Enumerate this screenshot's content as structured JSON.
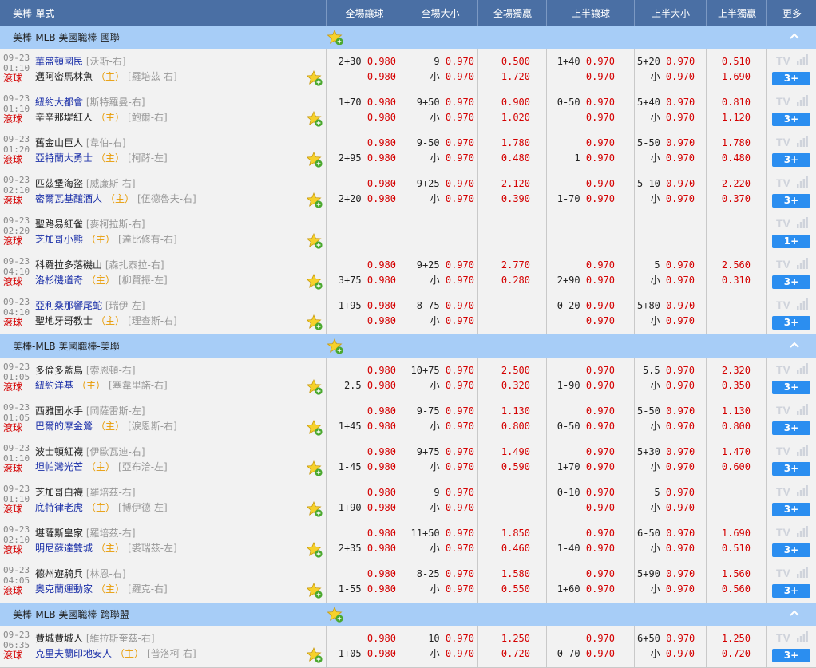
{
  "header": {
    "title": "美棒-單式",
    "cols": [
      "全場讓球",
      "全場大小",
      "全場獨贏",
      "上半讓球",
      "上半大小",
      "上半獨贏",
      "更多"
    ]
  },
  "colors": {
    "header_bg": "#4a6fa4",
    "league_bg": "#a7cdf7",
    "odds_red": "#d40000",
    "more_btn": "#2b8ef0"
  },
  "live_label": "滾球",
  "home_mark": "（主）",
  "tv_label": "TV",
  "leagues": [
    {
      "name": "美棒-MLB 美國職棒-國聯",
      "games": [
        {
          "date": "09-23",
          "time": "01:10",
          "t1": "華盛頓國民",
          "p1": "[沃斯-右]",
          "t2": "邁阿密馬林魚",
          "p2": "[羅培茲-右]",
          "fav": 1,
          "home": 2,
          "hc": [
            "2+30",
            "0.980",
            "",
            "0.980"
          ],
          "ou": [
            "9",
            "0.970",
            "小",
            "0.970"
          ],
          "ml": [
            "0.500",
            "1.720"
          ],
          "hhc": [
            "1+40",
            "0.970",
            "",
            "0.970"
          ],
          "hou": [
            "5+20",
            "0.970",
            "小",
            "0.970"
          ],
          "hml": [
            "0.510",
            "1.690"
          ],
          "more": "3+"
        },
        {
          "date": "09-23",
          "time": "01:10",
          "t1": "紐約大都會",
          "p1": "[斯特羅曼-右]",
          "t2": "辛辛那堤紅人",
          "p2": "[鮑爾-右]",
          "fav": 1,
          "home": 2,
          "hc": [
            "1+70",
            "0.980",
            "",
            "0.980"
          ],
          "ou": [
            "9+50",
            "0.970",
            "小",
            "0.970"
          ],
          "ml": [
            "0.900",
            "1.020"
          ],
          "hhc": [
            "0-50",
            "0.970",
            "",
            "0.970"
          ],
          "hou": [
            "5+40",
            "0.970",
            "小",
            "0.970"
          ],
          "hml": [
            "0.810",
            "1.120"
          ],
          "more": "3+"
        },
        {
          "date": "09-23",
          "time": "01:20",
          "t1": "舊金山巨人",
          "p1": "[韋伯-右]",
          "t2": "亞特蘭大勇士",
          "p2": "[柯酵-左]",
          "fav": 2,
          "home": 2,
          "hc": [
            "",
            "0.980",
            "2+95",
            "0.980"
          ],
          "ou": [
            "9-50",
            "0.970",
            "小",
            "0.970"
          ],
          "ml": [
            "1.780",
            "0.480"
          ],
          "hhc": [
            "",
            "0.970",
            "1",
            "0.970"
          ],
          "hou": [
            "5-50",
            "0.970",
            "小",
            "0.970"
          ],
          "hml": [
            "1.780",
            "0.480"
          ],
          "more": "3+"
        },
        {
          "date": "09-23",
          "time": "02:10",
          "t1": "匹茲堡海盜",
          "p1": "[威廉斯-右]",
          "t2": "密爾瓦基釀酒人",
          "p2": "[伍德魯夫-右]",
          "fav": 2,
          "home": 2,
          "hc": [
            "",
            "0.980",
            "2+20",
            "0.980"
          ],
          "ou": [
            "9+25",
            "0.970",
            "小",
            "0.970"
          ],
          "ml": [
            "2.120",
            "0.390"
          ],
          "hhc": [
            "",
            "0.970",
            "1-70",
            "0.970"
          ],
          "hou": [
            "5-10",
            "0.970",
            "小",
            "0.970"
          ],
          "hml": [
            "2.220",
            "0.370"
          ],
          "more": "3+"
        },
        {
          "date": "09-23",
          "time": "02:20",
          "t1": "聖路易紅雀",
          "p1": "[麥柯拉斯-右]",
          "t2": "芝加哥小熊",
          "p2": "[達比修有-右]",
          "fav": 2,
          "home": 2,
          "hc": [
            "",
            "",
            "",
            ""
          ],
          "ou": [
            "",
            "",
            "",
            ""
          ],
          "ml": [
            "",
            ""
          ],
          "hhc": [
            "",
            "",
            "",
            ""
          ],
          "hou": [
            "",
            "",
            "",
            ""
          ],
          "hml": [
            "",
            ""
          ],
          "more": "1+"
        },
        {
          "date": "09-23",
          "time": "04:10",
          "t1": "科羅拉多落磯山",
          "p1": "[森扎泰拉-右]",
          "t2": "洛杉磯道奇",
          "p2": "[柳賢振-左]",
          "fav": 2,
          "home": 2,
          "hc": [
            "",
            "0.980",
            "3+75",
            "0.980"
          ],
          "ou": [
            "9+25",
            "0.970",
            "小",
            "0.970"
          ],
          "ml": [
            "2.770",
            "0.280"
          ],
          "hhc": [
            "",
            "0.970",
            "2+90",
            "0.970"
          ],
          "hou": [
            "5",
            "0.970",
            "小",
            "0.970"
          ],
          "hml": [
            "2.560",
            "0.310"
          ],
          "more": "3+"
        },
        {
          "date": "09-23",
          "time": "04:10",
          "t1": "亞利桑那響尾蛇",
          "p1": "[瑞伊-左]",
          "t2": "聖地牙哥教士",
          "p2": "[理查斯-右]",
          "fav": 1,
          "home": 2,
          "hc": [
            "1+95",
            "0.980",
            "",
            "0.980"
          ],
          "ou": [
            "8-75",
            "0.970",
            "小",
            "0.970"
          ],
          "ml": [
            "",
            ""
          ],
          "hhc": [
            "0-20",
            "0.970",
            "",
            "0.970"
          ],
          "hou": [
            "5+80",
            "0.970",
            "小",
            "0.970"
          ],
          "hml": [
            "",
            ""
          ],
          "more": "3+"
        }
      ]
    },
    {
      "name": "美棒-MLB 美國職棒-美聯",
      "games": [
        {
          "date": "09-23",
          "time": "01:05",
          "t1": "多倫多藍鳥",
          "p1": "[索恩頓-右]",
          "t2": "紐約洋基",
          "p2": "[塞韋里諾-右]",
          "fav": 2,
          "home": 2,
          "hc": [
            "",
            "0.980",
            "2.5",
            "0.980"
          ],
          "ou": [
            "10+75",
            "0.970",
            "小",
            "0.970"
          ],
          "ml": [
            "2.500",
            "0.320"
          ],
          "hhc": [
            "",
            "0.970",
            "1-90",
            "0.970"
          ],
          "hou": [
            "5.5",
            "0.970",
            "小",
            "0.970"
          ],
          "hml": [
            "2.320",
            "0.350"
          ],
          "more": "3+"
        },
        {
          "date": "09-23",
          "time": "01:05",
          "t1": "西雅圖水手",
          "p1": "[岡薩雷斯-左]",
          "t2": "巴爾的摩金鶯",
          "p2": "[淚恩斯-右]",
          "fav": 2,
          "home": 2,
          "hc": [
            "",
            "0.980",
            "1+45",
            "0.980"
          ],
          "ou": [
            "9-75",
            "0.970",
            "小",
            "0.970"
          ],
          "ml": [
            "1.130",
            "0.800"
          ],
          "hhc": [
            "",
            "0.970",
            "0-50",
            "0.970"
          ],
          "hou": [
            "5-50",
            "0.970",
            "小",
            "0.970"
          ],
          "hml": [
            "1.130",
            "0.800"
          ],
          "more": "3+"
        },
        {
          "date": "09-23",
          "time": "01:10",
          "t1": "波士頓紅襪",
          "p1": "[伊歐瓦迪-右]",
          "t2": "坦帕灣光芒",
          "p2": "[亞布洽-左]",
          "fav": 2,
          "home": 2,
          "hc": [
            "",
            "0.980",
            "1-45",
            "0.980"
          ],
          "ou": [
            "9+75",
            "0.970",
            "小",
            "0.970"
          ],
          "ml": [
            "1.490",
            "0.590"
          ],
          "hhc": [
            "",
            "0.970",
            "1+70",
            "0.970"
          ],
          "hou": [
            "5+30",
            "0.970",
            "小",
            "0.970"
          ],
          "hml": [
            "1.470",
            "0.600"
          ],
          "more": "3+"
        },
        {
          "date": "09-23",
          "time": "01:10",
          "t1": "芝加哥白襪",
          "p1": "[羅培茲-右]",
          "t2": "底特律老虎",
          "p2": "[博伊德-左]",
          "fav": 2,
          "home": 2,
          "hc": [
            "",
            "0.980",
            "1+90",
            "0.980"
          ],
          "ou": [
            "9",
            "0.970",
            "小",
            "0.970"
          ],
          "ml": [
            "",
            ""
          ],
          "hhc": [
            "0-10",
            "0.970",
            "",
            "0.970"
          ],
          "hou": [
            "5",
            "0.970",
            "小",
            "0.970"
          ],
          "hml": [
            "",
            ""
          ],
          "more": "3+"
        },
        {
          "date": "09-23",
          "time": "02:10",
          "t1": "堪薩斯皇家",
          "p1": "[羅培茲-右]",
          "t2": "明尼蘇達雙城",
          "p2": "[裘瑞茲-左]",
          "fav": 2,
          "home": 2,
          "hc": [
            "",
            "0.980",
            "2+35",
            "0.980"
          ],
          "ou": [
            "11+50",
            "0.970",
            "小",
            "0.970"
          ],
          "ml": [
            "1.850",
            "0.460"
          ],
          "hhc": [
            "",
            "0.970",
            "1-40",
            "0.970"
          ],
          "hou": [
            "6-50",
            "0.970",
            "小",
            "0.970"
          ],
          "hml": [
            "1.690",
            "0.510"
          ],
          "more": "3+"
        },
        {
          "date": "09-23",
          "time": "04:05",
          "t1": "德州遊騎兵",
          "p1": "[林恩-右]",
          "t2": "奧克蘭運動家",
          "p2": "[羅克-右]",
          "fav": 2,
          "home": 2,
          "hc": [
            "",
            "0.980",
            "1-55",
            "0.980"
          ],
          "ou": [
            "8-25",
            "0.970",
            "小",
            "0.970"
          ],
          "ml": [
            "1.580",
            "0.550"
          ],
          "hhc": [
            "",
            "0.970",
            "1+60",
            "0.970"
          ],
          "hou": [
            "5+90",
            "0.970",
            "小",
            "0.970"
          ],
          "hml": [
            "1.560",
            "0.560"
          ],
          "more": "3+"
        }
      ]
    },
    {
      "name": "美棒-MLB 美國職棒-跨聯盟",
      "games": [
        {
          "date": "09-23",
          "time": "06:35",
          "t1": "費城費城人",
          "p1": "[維拉斯奎茲-右]",
          "t2": "克里夫蘭印地安人",
          "p2": "[普洛柯-右]",
          "fav": 2,
          "home": 2,
          "hc": [
            "",
            "0.980",
            "1+05",
            "0.980"
          ],
          "ou": [
            "10",
            "0.970",
            "小",
            "0.970"
          ],
          "ml": [
            "1.250",
            "0.720"
          ],
          "hhc": [
            "",
            "0.970",
            "0-70",
            "0.970"
          ],
          "hou": [
            "6+50",
            "0.970",
            "小",
            "0.970"
          ],
          "hml": [
            "1.250",
            "0.720"
          ],
          "more": "3+"
        }
      ]
    }
  ]
}
